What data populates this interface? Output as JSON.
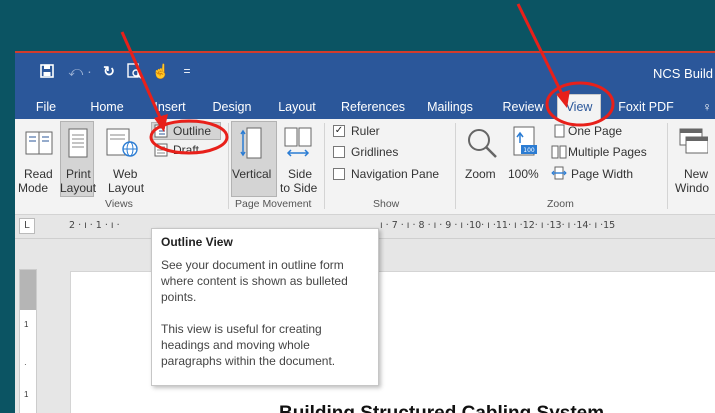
{
  "titlebar": {
    "doc_title": "NCS Build",
    "icons": [
      "save-icon",
      "undo-icon",
      "redo-icon",
      "print-preview-icon",
      "touch-mode-icon",
      "customize-quick-access-icon"
    ]
  },
  "tabs": [
    {
      "label": "File"
    },
    {
      "label": "Home"
    },
    {
      "label": "Insert"
    },
    {
      "label": "Design"
    },
    {
      "label": "Layout"
    },
    {
      "label": "References"
    },
    {
      "label": "Mailings"
    },
    {
      "label": "Review"
    },
    {
      "label": "View",
      "active": true
    },
    {
      "label": "Foxit PDF"
    }
  ],
  "ribbon": {
    "views": {
      "read_mode_1": "Read",
      "read_mode_2": "Mode",
      "print_layout_1": "Print",
      "print_layout_2": "Layout",
      "web_layout_1": "Web",
      "web_layout_2": "Layout",
      "outline": "Outline",
      "draft": "Draft",
      "group_name": "Views"
    },
    "page_movement": {
      "vertical": "Vertical",
      "side_1": "Side",
      "side_2": "to Side",
      "group_name": "Page Movement"
    },
    "show": {
      "ruler": "Ruler",
      "ruler_checked": true,
      "gridlines": "Gridlines",
      "gridlines_checked": false,
      "navigation_pane": "Navigation Pane",
      "navigation_pane_checked": false,
      "group_name": "Show"
    },
    "zoom": {
      "zoom": "Zoom",
      "percent": "100%",
      "one_page": "One Page",
      "multiple_pages": "Multiple Pages",
      "page_width": "Page Width",
      "group_name": "Zoom"
    },
    "window": {
      "new_1": "New",
      "new_2": "Windo"
    }
  },
  "ruler": {
    "tab_selector": "L",
    "left_text": "2 · ı · 1 · ı ·",
    "right_text": "ı · 7 · ı · 8 · ı · 9 · ı ·10· ı ·11· ı ·12· ı ·13· ı ·14· ı ·15"
  },
  "tooltip": {
    "title": "Outline View",
    "body1": "See your document in outline form where content is shown as bulleted points.",
    "body2": "This view is useful for creating headings and moving whole paragraphs within the document."
  },
  "document": {
    "heading": "Building Structured Cabling System"
  },
  "colors": {
    "background": "#0b5463",
    "word_blue": "#2b579a",
    "annotation_red": "#e8201a"
  }
}
